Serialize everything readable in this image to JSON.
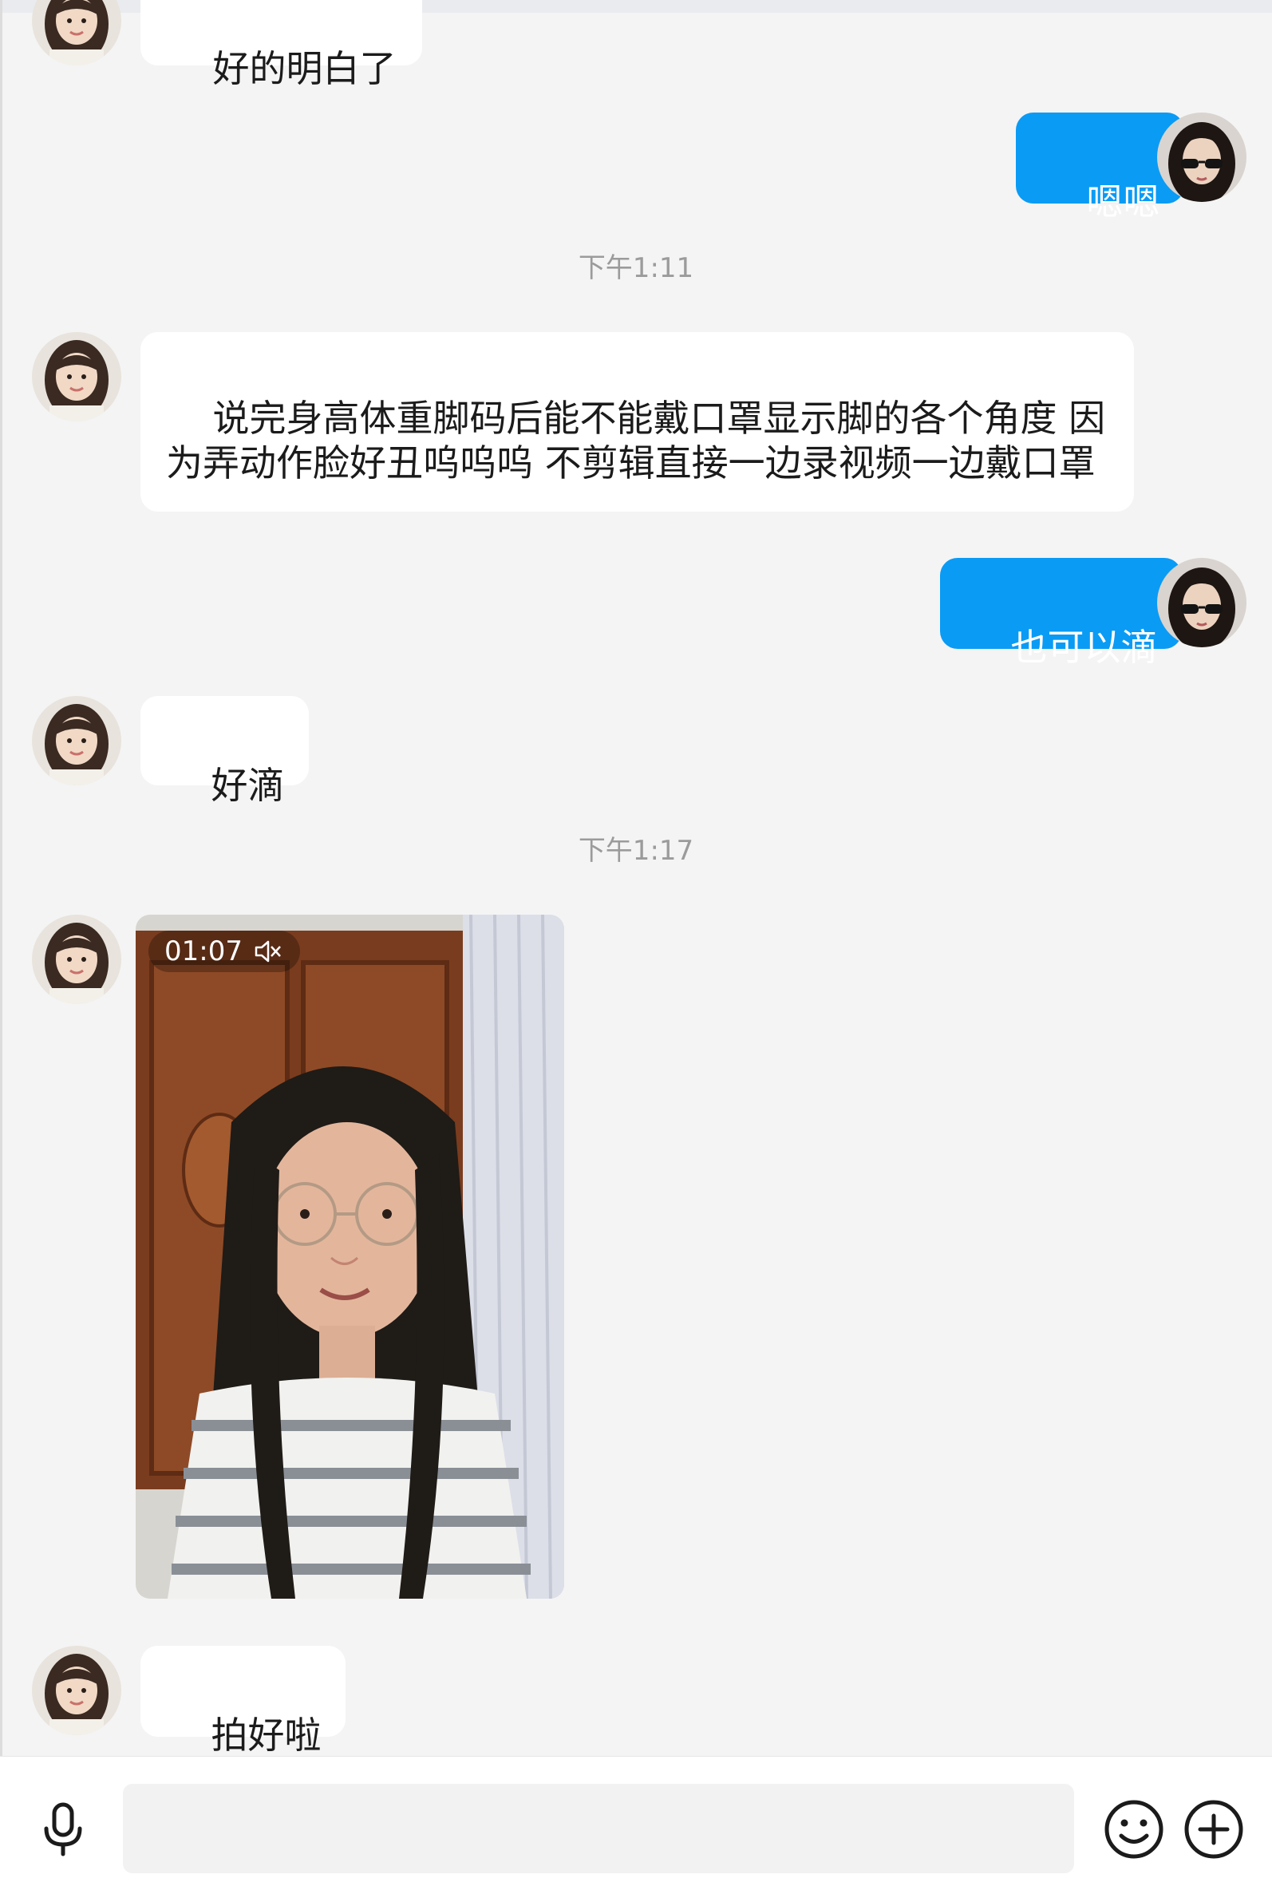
{
  "colors": {
    "outgoing_bubble": "#0a9bf5",
    "incoming_bubble": "#ffffff",
    "chat_background": "#f4f4f4",
    "timestamp_text": "#9b9b9b"
  },
  "messages": [
    {
      "id": "m0",
      "side": "in",
      "text": "好的明白了"
    },
    {
      "id": "m1",
      "side": "out",
      "text": "嗯嗯"
    },
    {
      "id": "ts1",
      "type": "timestamp",
      "text": "下午1:11"
    },
    {
      "id": "m2",
      "side": "in",
      "text": "说完身高体重脚码后能不能戴口罩显示脚的各个角度 因为弄动作脸好丑呜呜呜 不剪辑直接一边录视频一边戴口罩"
    },
    {
      "id": "m3",
      "side": "out",
      "text": "也可以滴"
    },
    {
      "id": "m4",
      "side": "in",
      "text": "好滴"
    },
    {
      "id": "ts2",
      "type": "timestamp",
      "text": "下午1:17"
    },
    {
      "id": "m5",
      "side": "in",
      "type": "video",
      "duration": "01:07",
      "muted": true
    },
    {
      "id": "m6",
      "side": "in",
      "text": "拍好啦"
    }
  ],
  "input_bar": {
    "icons": [
      "microphone-icon",
      "emoji-icon",
      "add-icon"
    ],
    "input_value": ""
  }
}
